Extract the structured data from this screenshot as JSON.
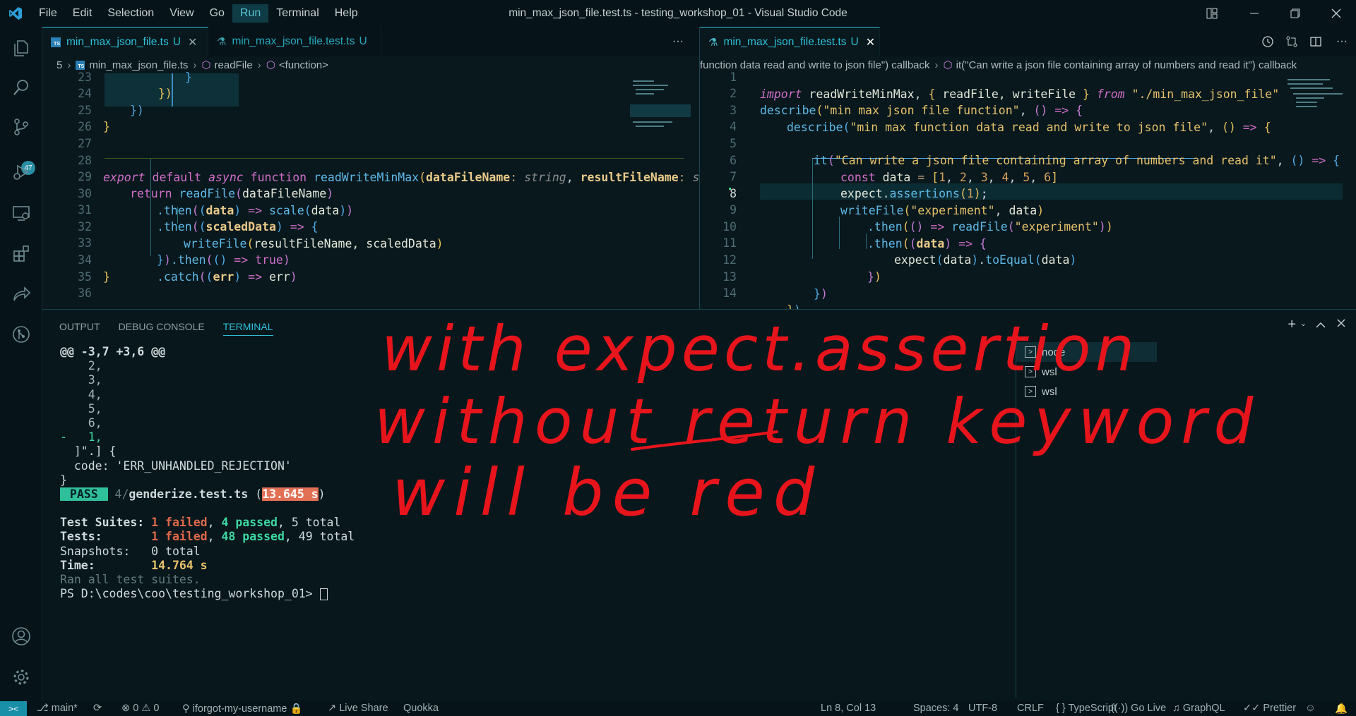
{
  "window": {
    "title": "min_max_json_file.test.ts - testing_workshop_01 - Visual Studio Code",
    "menu": [
      "File",
      "Edit",
      "Selection",
      "View",
      "Go",
      "Run",
      "Terminal",
      "Help"
    ],
    "active_menu": "Run"
  },
  "activity_bar": {
    "icons": [
      "explorer-icon",
      "search-icon",
      "source-control-icon",
      "run-debug-icon",
      "remote-explorer-icon",
      "extensions-icon",
      "live-share-icon",
      "gitlens-icon",
      "account-icon",
      "settings-gear-icon"
    ],
    "scm_badge": "47"
  },
  "left_editor": {
    "tabs": [
      {
        "label": "min_max_json_file.ts",
        "status": "U",
        "icon": "typescript-file-icon",
        "active": true
      },
      {
        "label": "min_max_json_file.test.ts",
        "status": "U",
        "icon": "test-flask-icon",
        "active": false
      }
    ],
    "more_label": "···",
    "breadcrumb": [
      "5",
      "min_max_json_file.ts",
      "readFile",
      "<function>"
    ],
    "line_numbers": [
      "23",
      "24",
      "25",
      "26",
      "27",
      "28",
      "29",
      "30",
      "31",
      "32",
      "33",
      "34",
      "35",
      "36"
    ],
    "code": {
      "l23": "}",
      "l24": "})",
      "l25": "})",
      "l26": "}",
      "l28_export": "export",
      "l28_default": "default",
      "l28_async": "async",
      "l28_function": "function",
      "l28_name": "readWriteMinMax",
      "l28_p1": "dataFileName",
      "l28_t1": "string",
      "l28_p2": "resultFileName",
      "l28_t2": "str",
      "l29_return": "return",
      "l29_call": "readFile",
      "l29_arg": "dataFileName",
      "l30_then": ".then",
      "l30_data": "data",
      "l30_arrow": "=>",
      "l30_scale": "scale",
      "l31_then": ".then",
      "l31_arg": "scaledData",
      "l31_arrow": "=>",
      "l32_call": "writeFile",
      "l32_args": "resultFileName, scaledData",
      "l33_then": ".then",
      "l33_arrow": "=>",
      "l33_true": "true",
      "l34_catch": ".catch",
      "l34_err": "err",
      "l34_arrow": "=>",
      "l35": "}"
    }
  },
  "right_editor": {
    "tabs": [
      {
        "label": "min_max_json_file.test.ts",
        "status": "U",
        "icon": "test-flask-icon",
        "active": true
      }
    ],
    "breadcrumb": [
      "function data read and write to json file\") callback",
      "it(\"Can write a json file containing array of numbers and read it\") callback"
    ],
    "line_numbers": [
      "1",
      "2",
      "3",
      "4",
      "5",
      "6",
      "7",
      "8",
      "9",
      "10",
      "11",
      "12",
      "13",
      "14"
    ],
    "current_line": "8",
    "code": {
      "l1_import": "import",
      "l1_default": "readWriteMinMax",
      "l1_named": "readFile, writeFile",
      "l1_from": "from",
      "l1_path": "\"./min_max_json_file\"",
      "l2_describe": "describe",
      "l2_str": "\"min max json file function\"",
      "l3_describe": "describe",
      "l3_str": "\"min max function data read and write to json file\"",
      "l5_it": "it",
      "l5_str": "\"Can write a json file containing array of numbers and read it\"",
      "l6_const": "const",
      "l6_var": "data",
      "l6_values": [
        "1",
        "2",
        "3",
        "4",
        "5",
        "6"
      ],
      "l7_expect": "expect",
      "l7_method": "assertions",
      "l7_arg": "1",
      "l8_call": "writeFile",
      "l8_str": "\"experiment\"",
      "l8_arg": "data",
      "l9_then": ".then",
      "l9_call": "readFile",
      "l9_str": "\"experiment\"",
      "l10_then": ".then",
      "l10_arg": "data",
      "l11_expect": "expect",
      "l11_arg": "data",
      "l11_method": "toEqual",
      "l11_arg2": "data"
    }
  },
  "panel": {
    "tabs": [
      "OUTPUT",
      "DEBUG CONSOLE",
      "TERMINAL"
    ],
    "active_tab": "TERMINAL",
    "terminal_lines": {
      "hunk": "@@ -3,7 +3,6 @@",
      "n2": "    2,",
      "n3": "    3,",
      "n4": "    4,",
      "n5": "    5,",
      "n6": "    6,",
      "minus1": "-   1,",
      "close": "  ]\".] {",
      "code": "  code: 'ERR_UNHANDLED_REJECTION'",
      "brace": "}",
      "pass_badge": " PASS ",
      "pass_dir": " 4/",
      "pass_file": "genderize.test.ts",
      "pass_time_open": " (",
      "pass_time": "13.645 s",
      "pass_time_close": ")",
      "suites_label": "Test Suites: ",
      "suites_failed": "1 failed",
      "suites_passed": "4 passed",
      "suites_total": ", 5 total",
      "tests_label": "Tests:       ",
      "tests_failed": "1 failed",
      "tests_passed": "48 passed",
      "tests_total": ", 49 total",
      "snapshots": "Snapshots:   0 total",
      "time_label": "Time:        ",
      "time_value": "14.764 s",
      "ran": "Ran all test suites.",
      "prompt": "PS D:\\codes\\coo\\testing_workshop_01> "
    },
    "terminal_instances": [
      "node",
      "wsl",
      "wsl"
    ]
  },
  "annotation": {
    "line1": "with expect.assertion",
    "line2": "without return keyword",
    "line3": "will be red",
    "color": "#e8141c"
  },
  "status_bar": {
    "branch": "main*",
    "errors": "0",
    "warnings": "0",
    "account": "iforgot-my-username",
    "live_share": "Live Share",
    "quokka": "Quokka",
    "position": "Ln 8, Col 13",
    "spaces": "Spaces: 4",
    "encoding": "UTF-8",
    "eol": "CRLF",
    "language": "TypeScript",
    "go_live": "Go Live",
    "graphql": "GraphQL",
    "prettier": "Prettier"
  },
  "colors": {
    "accent": "#2fbfd8",
    "background": "#08181d",
    "annotation_red": "#e8141c"
  }
}
